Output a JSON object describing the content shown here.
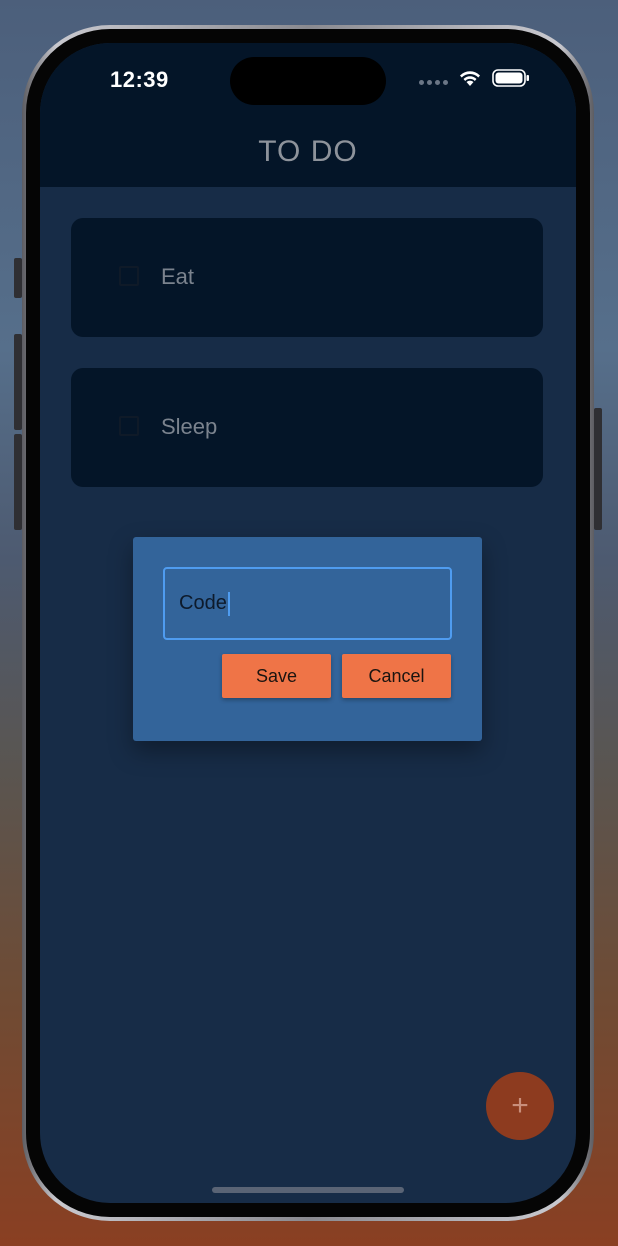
{
  "status_bar": {
    "time": "12:39"
  },
  "app_bar": {
    "title": "TO DO"
  },
  "todos": [
    {
      "label": "Eat",
      "checked": false
    },
    {
      "label": "Sleep",
      "checked": false
    }
  ],
  "dialog": {
    "input_value": "Code",
    "save_label": "Save",
    "cancel_label": "Cancel"
  },
  "fab": {
    "icon": "plus-icon",
    "glyph": "+"
  },
  "colors": {
    "app_bar_bg": "#041528",
    "screen_bg": "#172c47",
    "dialog_bg": "#33649a",
    "accent_button": "#ef7447",
    "input_border": "#4f9cf0",
    "fab_bg": "#8d3b1f"
  }
}
